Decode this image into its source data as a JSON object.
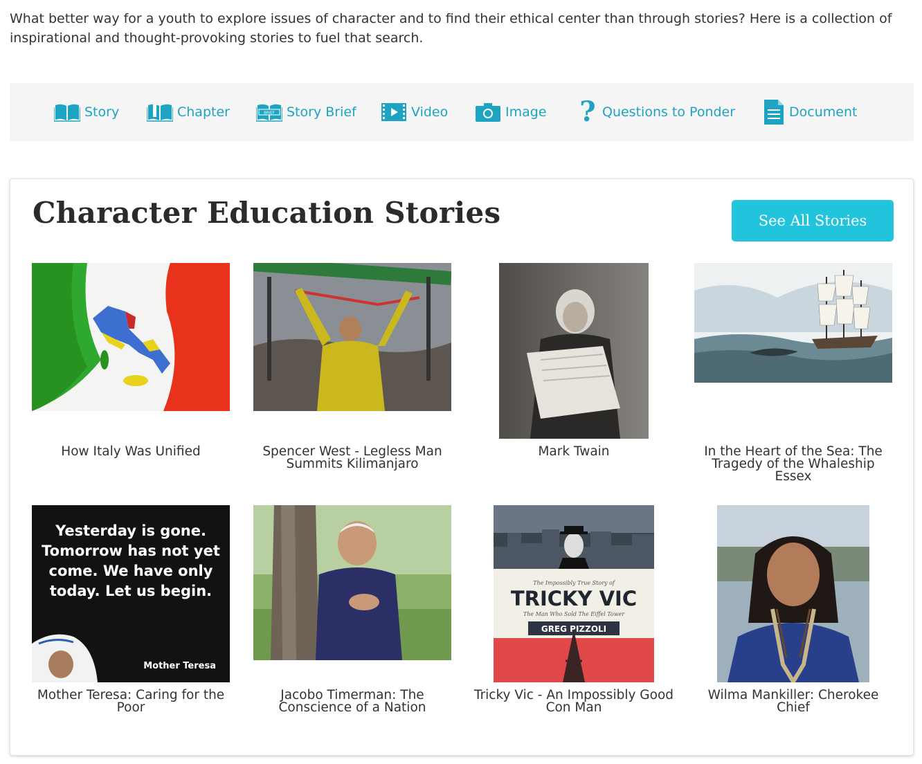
{
  "intro": "What better way for a youth to explore issues of character and to find their ethical center than through stories? Here is a collection of inspirational and thought-provoking stories to fuel that search.",
  "legend": [
    {
      "label": "Story",
      "icon": "open-book-icon"
    },
    {
      "label": "Chapter",
      "icon": "chapter-book-icon"
    },
    {
      "label": "Story Brief",
      "icon": "brief-book-icon"
    },
    {
      "label": "Video",
      "icon": "film-icon"
    },
    {
      "label": "Image",
      "icon": "camera-icon"
    },
    {
      "label": "Questions to Ponder",
      "icon": "question-mark-icon"
    },
    {
      "label": "Document",
      "icon": "document-icon"
    }
  ],
  "accent_color": "#1ea4c2",
  "button_color": "#22c4dd",
  "section": {
    "title": "Character Education Stories",
    "see_all": "See All Stories"
  },
  "stories": [
    {
      "title": "How Italy Was Unified",
      "image": "italian-flag-with-map-image"
    },
    {
      "title": "Spencer West - Legless Man Summits Kilimanjaro",
      "image": "man-at-summit-photo"
    },
    {
      "title": "Mark Twain",
      "image": "mark-twain-reading-photo"
    },
    {
      "title": "In the Heart of the Sea: The Tragedy of the Whaleship Essex",
      "image": "whaleship-illustration"
    },
    {
      "title": "Mother Teresa: Caring for the Poor",
      "image": "mother-teresa-quote-image",
      "quote": "Yesterday is gone. Tomorrow has not yet come. We have only today. Let us begin.",
      "caption": "Mother Teresa"
    },
    {
      "title": "Jacobo Timerman: The Conscience of a Nation",
      "image": "jacobo-timerman-photo"
    },
    {
      "title": "Tricky Vic - An Impossibly Good Con Man",
      "image": "tricky-vic-book-cover",
      "cover_small": "The Impossibly True Story of",
      "cover_title": "TRICKY VIC",
      "cover_sub": "The Man Who Sold The Eiffel Tower",
      "cover_author": "GREG PIZZOLI"
    },
    {
      "title": "Wilma Mankiller: Cherokee Chief",
      "image": "wilma-mankiller-photo"
    }
  ]
}
